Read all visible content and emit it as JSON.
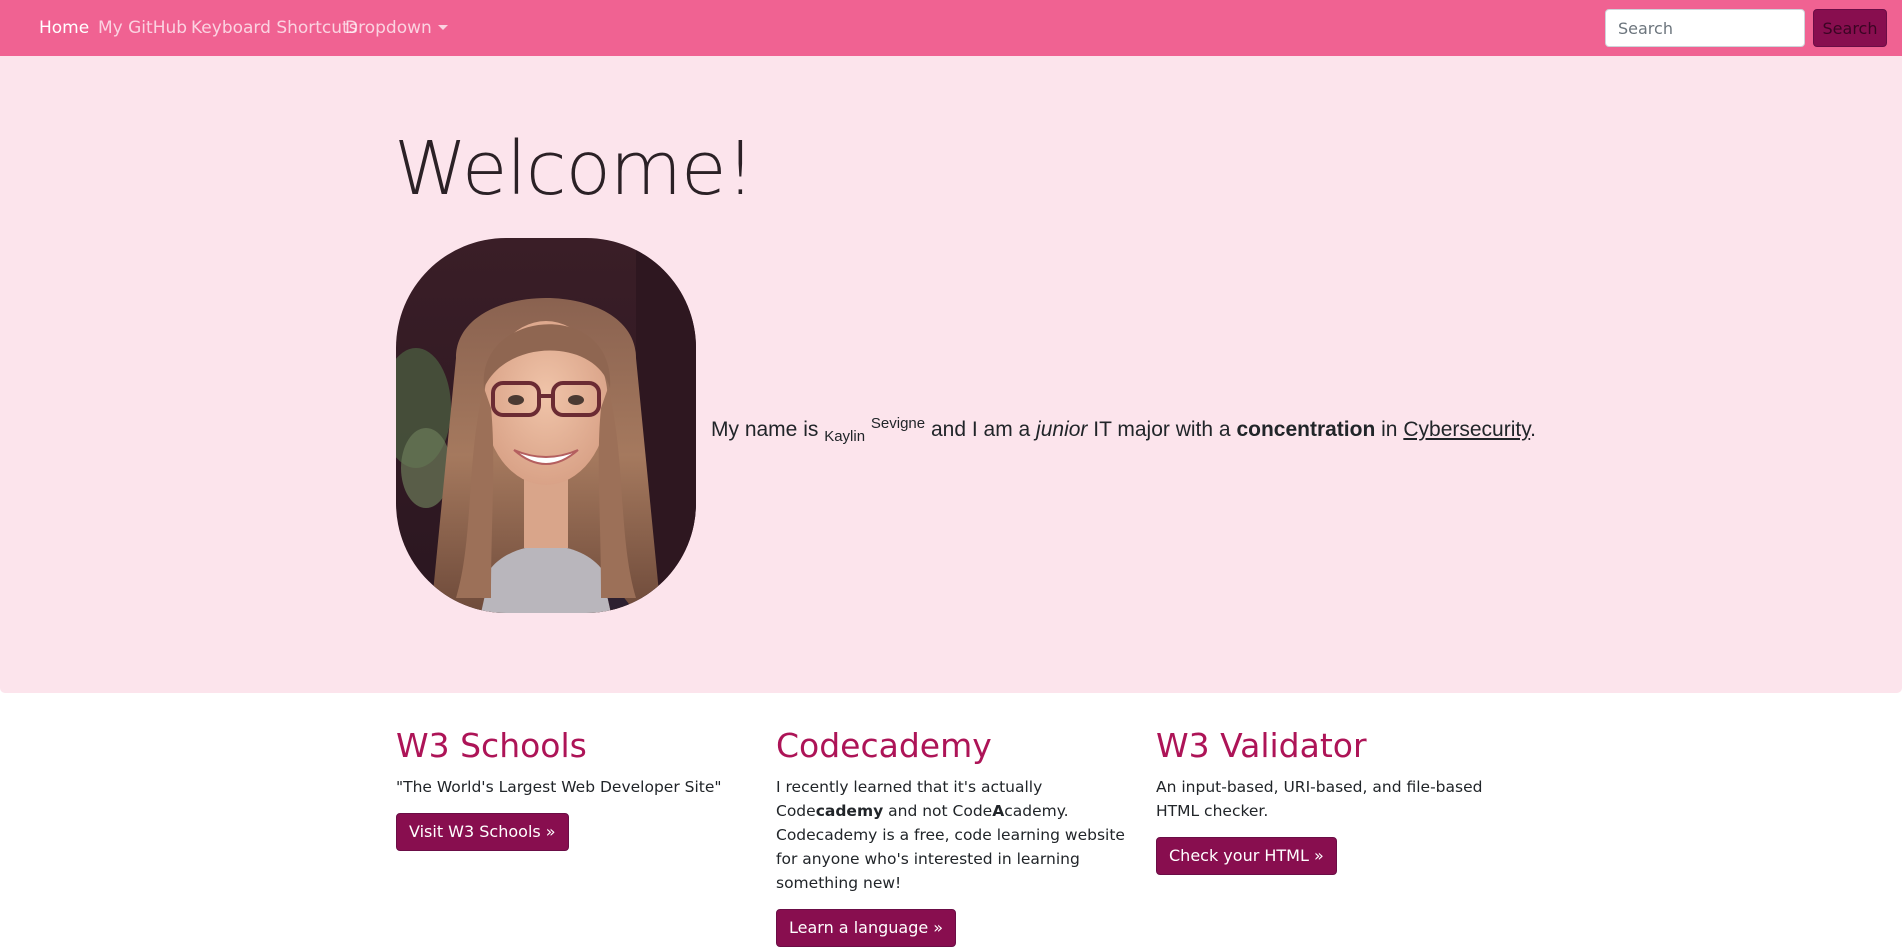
{
  "navbar": {
    "links": [
      {
        "label": "Home"
      },
      {
        "label": "My GitHub"
      },
      {
        "label": "Keyboard Shortcuts"
      },
      {
        "label": "Dropdown"
      }
    ],
    "search": {
      "placeholder": "Search",
      "value": "",
      "button_label": "Search"
    }
  },
  "hero": {
    "title": "Welcome!",
    "intro": {
      "prefix": "My name is",
      "first_name": "Kaylin",
      "last_name": "Sevigne",
      "text2": "and I am a",
      "emphasis": "junior",
      "text3": "IT major with a",
      "strong": "concentration",
      "text4": "in",
      "link": "Cybersecurity",
      "suffix": "."
    }
  },
  "columns": [
    {
      "heading": "W3 Schools",
      "body": "\"The World's Large­st Web Developer Site\"",
      "button": "Visit W3 Schools »"
    },
    {
      "heading": "Codecademy",
      "body": {
        "part1": "I recently learned that it's actually Code",
        "bold1": "cademy",
        "part2": " and not Code",
        "bold2": "A",
        "part3": "cademy. Codecademy is a free, code learning website for anyone who's interested in learning something new!"
      },
      "button": "Learn a language »"
    },
    {
      "heading": "W3 Validator",
      "body": "An input-based, URI-based, and file-based HTML checker.",
      "button": "Check your HTML »"
    }
  ],
  "colors": {
    "navbar": "#f06292",
    "jumbotron": "#fce4ec",
    "heading": "#ad1457",
    "button": "#880e4f"
  }
}
